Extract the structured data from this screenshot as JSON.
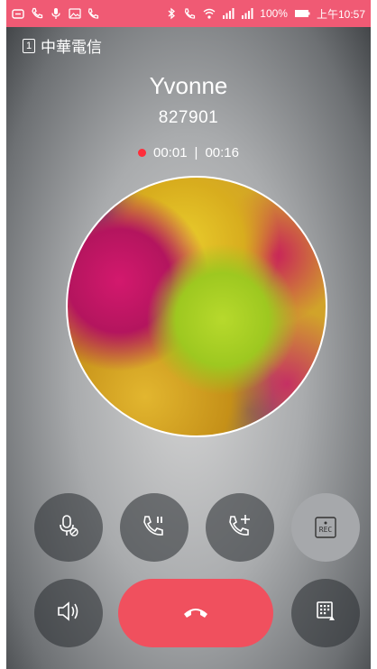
{
  "status_bar": {
    "percent": "100%",
    "time": "上午10:57",
    "icons": [
      "calendar-icon",
      "phone-icon",
      "mic-icon",
      "image-icon",
      "call-forward-icon",
      "bluetooth-icon",
      "wifi-calling-icon",
      "wifi-icon",
      "signal-sim1-icon",
      "signal-sim2-icon",
      "battery-icon"
    ]
  },
  "carrier": {
    "sim": "1",
    "name": "中華電信"
  },
  "call": {
    "name": "Yvonne",
    "number": "827901",
    "record_elapsed": "00:01",
    "separator": "|",
    "call_duration": "00:16"
  },
  "controls": {
    "rec_label": "REC",
    "end_call_color": "#f0505e",
    "status_color": "#f05a74"
  }
}
